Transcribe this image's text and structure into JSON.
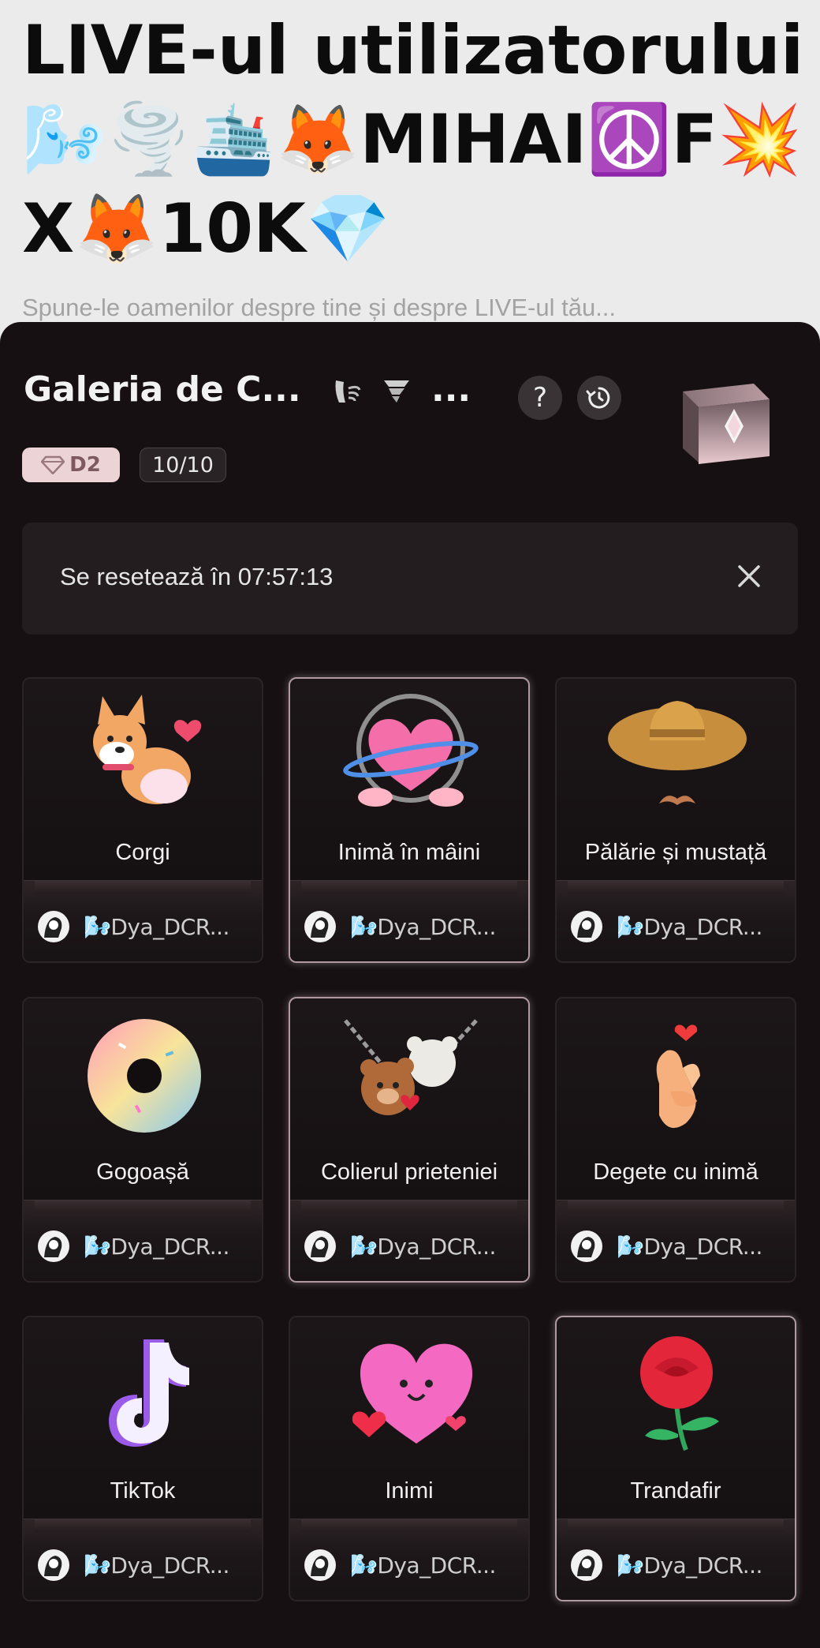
{
  "background": {
    "title": "LIVE-ul utilizatorului 🌬️🌪️🛳️🦊MIHAI☮️F💥X🦊10K💎",
    "subtitle": "Spune-le oamenilor despre tine și despre LIVE-ul tău..."
  },
  "gallery": {
    "title": "Galeria de C...",
    "title_suffix": "...",
    "help_label": "?",
    "badge_level": "D2",
    "count": "10/10",
    "reset_text": "Se resetează în 07:57:13"
  },
  "cards": [
    {
      "name": "Corgi",
      "user": "Dya_DCR..."
    },
    {
      "name": "Inimă în mâini",
      "user": "Dya_DCR..."
    },
    {
      "name": "Pălărie și mustață",
      "user": "Dya_DCR..."
    },
    {
      "name": "Gogoașă",
      "user": "Dya_DCR..."
    },
    {
      "name": "Colierul prieteniei",
      "user": "Dya_DCR..."
    },
    {
      "name": "Degete cu inimă",
      "user": "Dya_DCR..."
    },
    {
      "name": "TikTok",
      "user": "Dya_DCR..."
    },
    {
      "name": "Inimi",
      "user": "Dya_DCR..."
    },
    {
      "name": "Trandafir",
      "user": "Dya_DCR..."
    }
  ],
  "colors": {
    "sheet_bg": "#161012",
    "badge_bg": "#ecd3d5",
    "selected_border": "#b09aa0"
  }
}
